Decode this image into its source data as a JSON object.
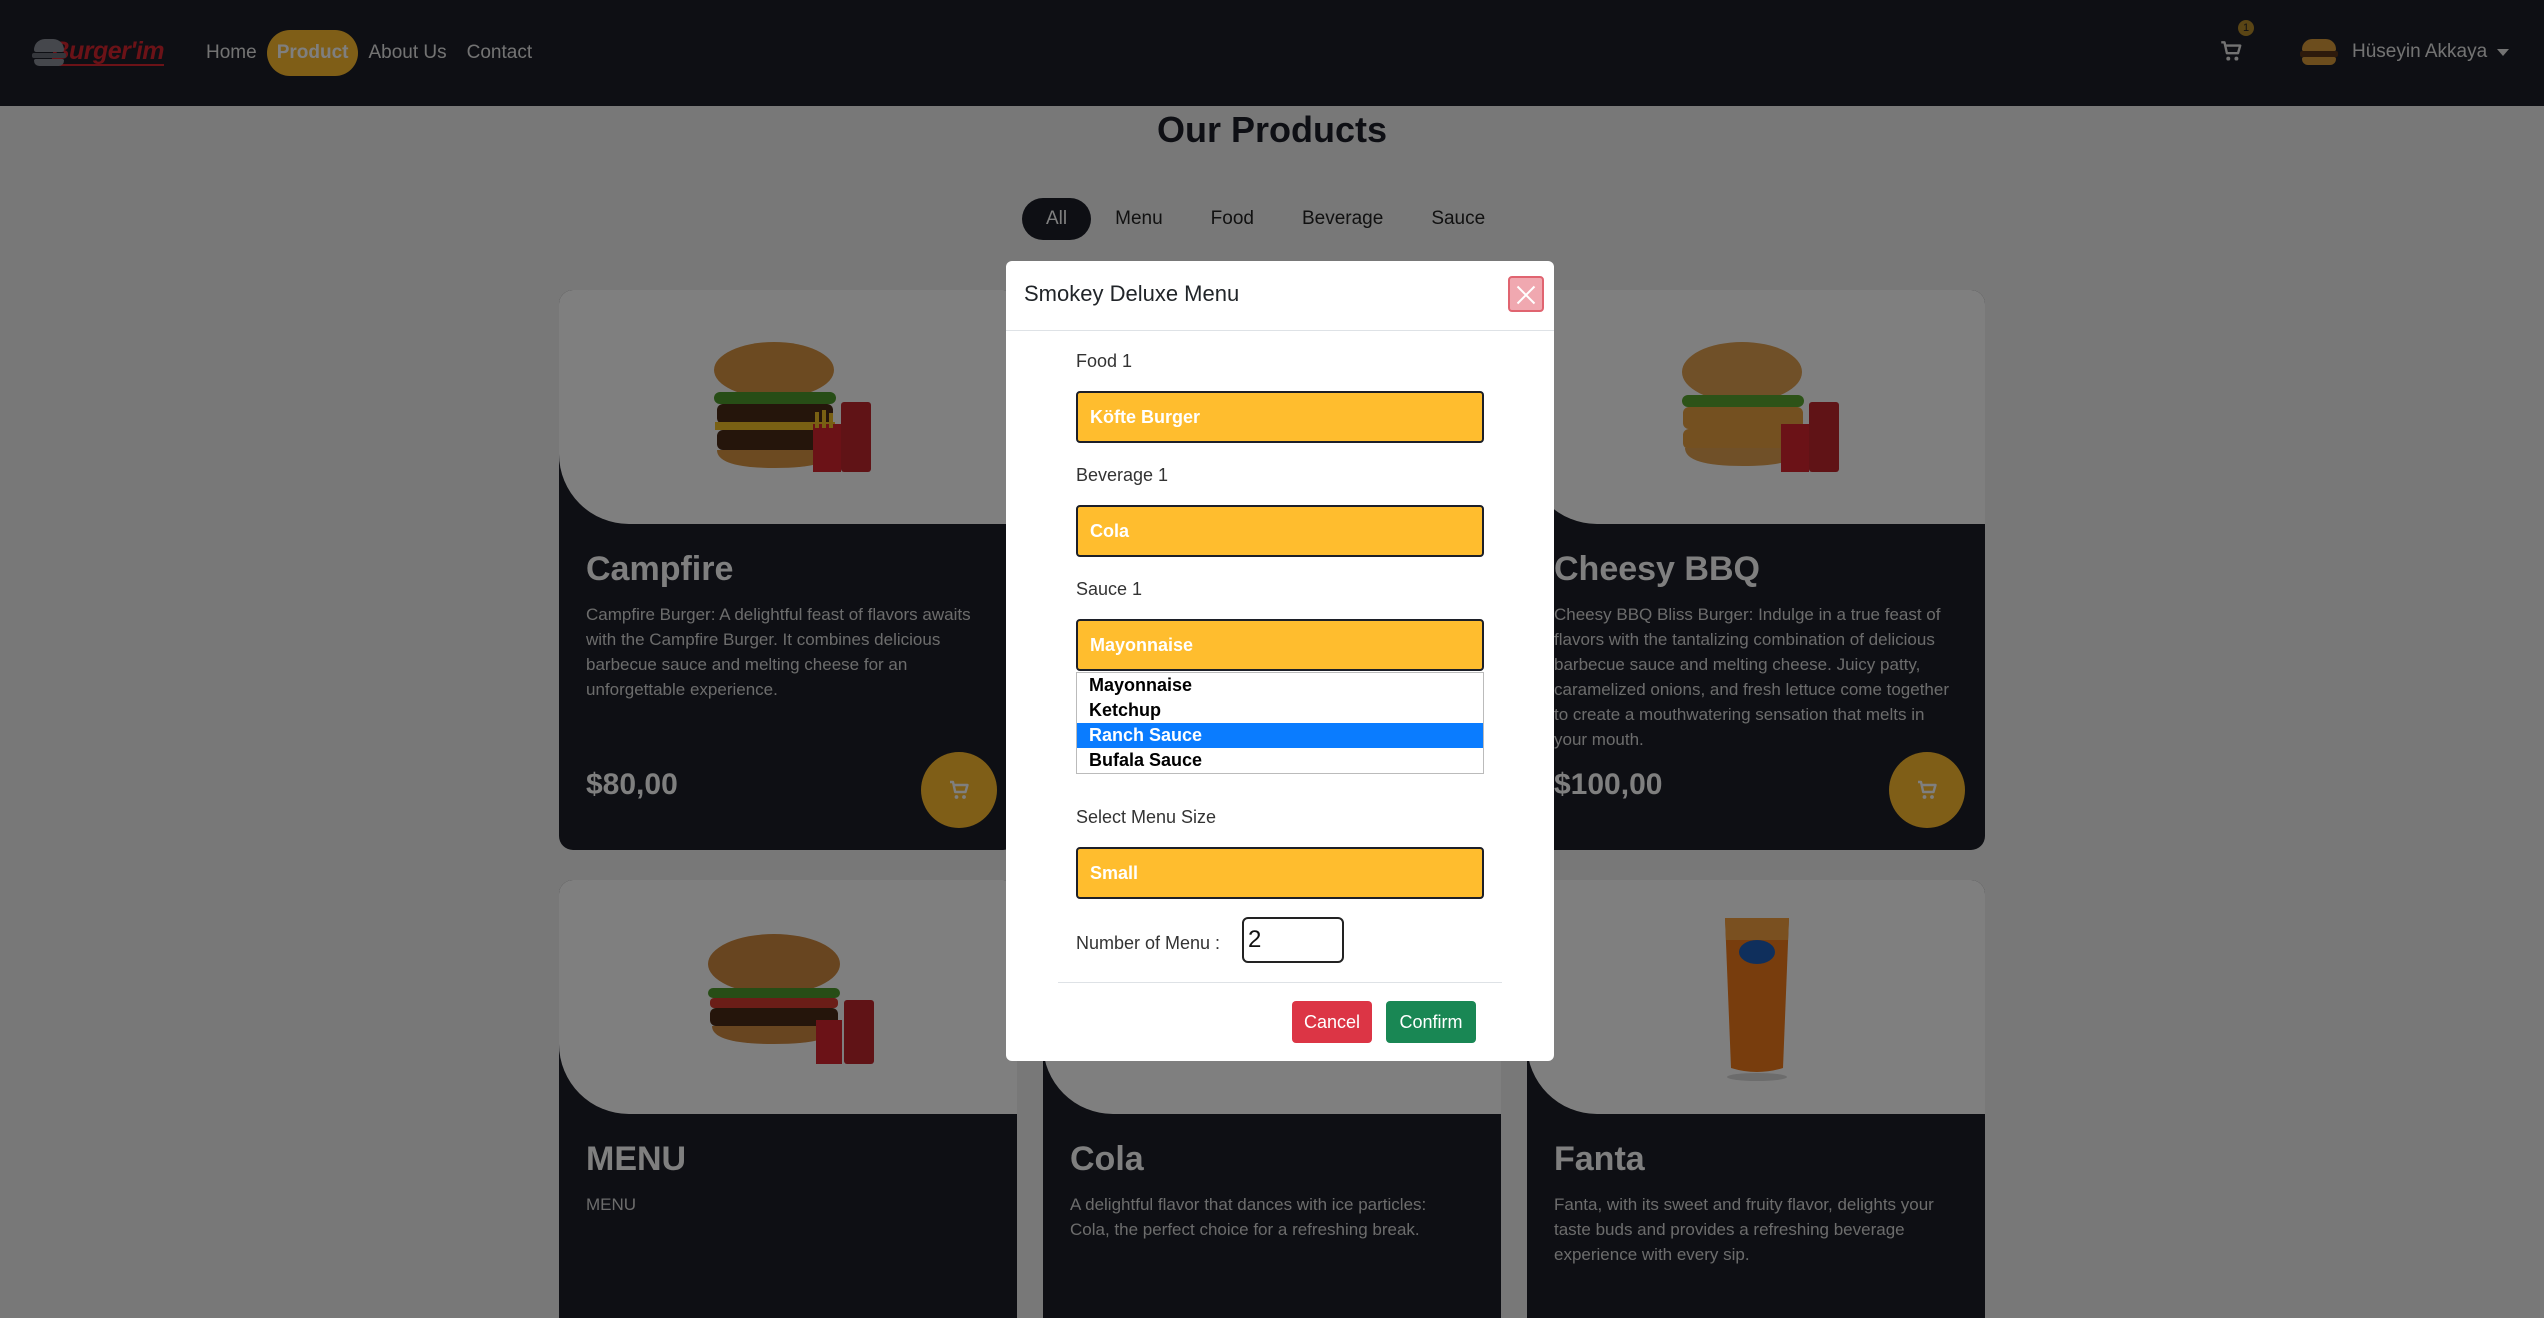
{
  "navbar": {
    "brand": "Burger'im",
    "links": [
      "Home",
      "Product",
      "About Us",
      "Contact"
    ],
    "active_link": "Product",
    "cart_count": "1",
    "user_name": "Hüseyin Akkaya"
  },
  "page": {
    "title": "Our Products",
    "filters": [
      "All",
      "Menu",
      "Food",
      "Beverage",
      "Sauce"
    ],
    "active_filter": "All"
  },
  "products": [
    {
      "name": "Campfire",
      "description": "Campfire Burger: A delightful feast of flavors awaits with the Campfire Burger. It combines delicious barbecue sauce and melting cheese for an unforgettable experience.",
      "price": "$80,00"
    },
    {
      "name": "Cheesy BBQ",
      "description": "Cheesy BBQ Bliss Burger: Indulge in a true feast of flavors with the tantalizing combination of delicious barbecue sauce and melting cheese. Juicy patty, caramelized onions, and fresh lettuce come together to create a mouthwatering sensation that melts in your mouth.",
      "price": "$100,00"
    },
    {
      "name": "MENU",
      "description": "MENU",
      "price": ""
    },
    {
      "name": "Cola",
      "description": "A delightful flavor that dances with ice particles: Cola, the perfect choice for a refreshing break.",
      "price": ""
    },
    {
      "name": "Fanta",
      "description": "Fanta, with its sweet and fruity flavor, delights your taste buds and provides a refreshing beverage experience with every sip.",
      "price": ""
    }
  ],
  "modal": {
    "title": "Smokey Deluxe Menu",
    "food_label": "Food 1",
    "food_value": "Köfte Burger",
    "beverage_label": "Beverage 1",
    "beverage_value": "Cola",
    "sauce_label": "Sauce 1",
    "sauce_value": "Mayonnaise",
    "sauce_options": [
      "Mayonnaise",
      "Ketchup",
      "Ranch Sauce",
      "Bufala Sauce"
    ],
    "sauce_highlighted": "Ranch Sauce",
    "size_label": "Select Menu Size",
    "size_value": "Small",
    "qty_label": "Number of Menu :",
    "qty_value": "2",
    "cancel_label": "Cancel",
    "confirm_label": "Confirm"
  },
  "colors": {
    "navbar": "#1c1f28",
    "accent": "#ffbd2e",
    "cancel": "#dc3545",
    "confirm": "#198754",
    "highlight": "#0a7cff"
  },
  "icons": [
    "burger-logo-icon",
    "cart-icon",
    "user-avatar-icon",
    "caret-down-icon",
    "close-icon"
  ]
}
